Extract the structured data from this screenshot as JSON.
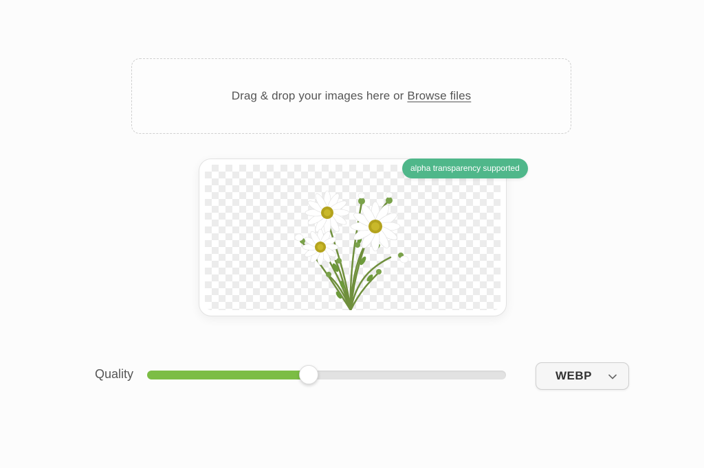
{
  "dropzone": {
    "prompt": "Drag & drop your images here or",
    "browse_label": "Browse files"
  },
  "preview": {
    "badge": "alpha transparency supported",
    "image": "daisy-bouquet"
  },
  "quality": {
    "label": "Quality",
    "value_fraction": 0.45
  },
  "format": {
    "selected": "WEBP",
    "icon": "chevron-down-icon"
  },
  "colors": {
    "accent_green": "#7cbd45",
    "badge_green": "#4fb78a"
  }
}
